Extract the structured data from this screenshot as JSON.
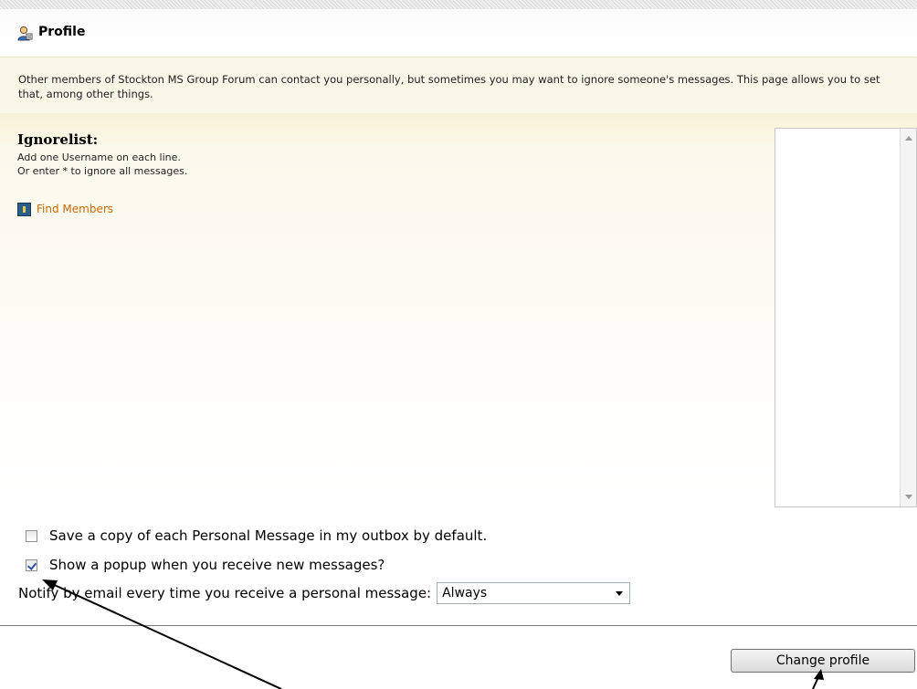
{
  "header": {
    "title": "Profile",
    "icon": "user-profile-icon"
  },
  "intro": "Other members of Stockton MS Group Forum can contact you personally, but sometimes you may want to ignore someone's messages. This page allows you to set that, among other things.",
  "ignorelist": {
    "title": "Ignorelist:",
    "hint1": "Add one Username on each line.",
    "hint2": "Or enter * to ignore all messages.",
    "find_members_label": "Find Members",
    "value": ""
  },
  "options": {
    "save_copy_label": "Save a copy of each Personal Message in my outbox by default.",
    "save_copy_checked": false,
    "popup_label": "Show a popup when you receive new messages?",
    "popup_checked": true,
    "notify_label": "Notify by email every time you receive a personal message:",
    "notify_value": "Always"
  },
  "submit_label": "Change profile"
}
